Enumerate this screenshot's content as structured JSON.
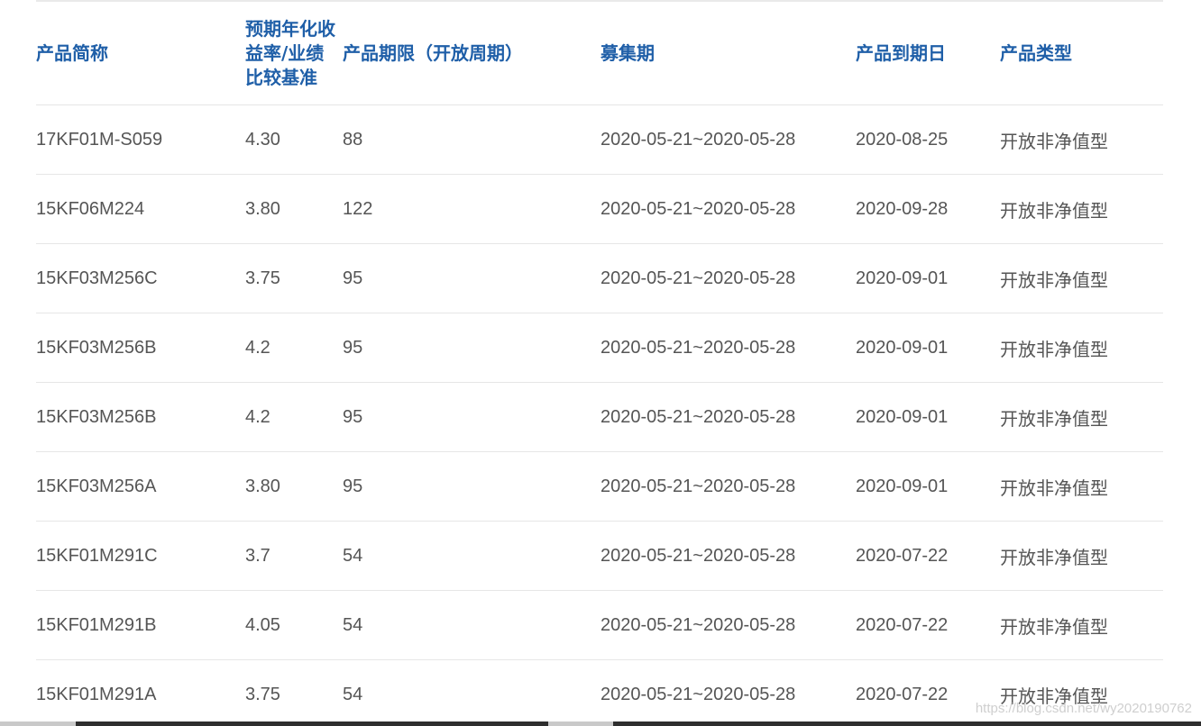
{
  "table": {
    "headers": {
      "name": "产品简称",
      "yield_line1": "预期年化收",
      "yield_line2": "益率/业绩",
      "yield_line3": "比较基准",
      "term": "产品期限（开放周期）",
      "raise_period": "募集期",
      "maturity": "产品到期日",
      "type": "产品类型"
    },
    "rows": [
      {
        "name": "17KF01M-S059",
        "yield": "4.30",
        "term": "88",
        "raise_period": "2020-05-21~2020-05-28",
        "maturity": "2020-08-25",
        "type": "开放非净值型"
      },
      {
        "name": "15KF06M224",
        "yield": "3.80",
        "term": "122",
        "raise_period": "2020-05-21~2020-05-28",
        "maturity": "2020-09-28",
        "type": "开放非净值型"
      },
      {
        "name": "15KF03M256C",
        "yield": "3.75",
        "term": "95",
        "raise_period": "2020-05-21~2020-05-28",
        "maturity": "2020-09-01",
        "type": "开放非净值型"
      },
      {
        "name": "15KF03M256B",
        "yield": "4.2",
        "term": "95",
        "raise_period": "2020-05-21~2020-05-28",
        "maturity": "2020-09-01",
        "type": "开放非净值型"
      },
      {
        "name": "15KF03M256B",
        "yield": "4.2",
        "term": "95",
        "raise_period": "2020-05-21~2020-05-28",
        "maturity": "2020-09-01",
        "type": "开放非净值型"
      },
      {
        "name": "15KF03M256A",
        "yield": "3.80",
        "term": "95",
        "raise_period": "2020-05-21~2020-05-28",
        "maturity": "2020-09-01",
        "type": "开放非净值型"
      },
      {
        "name": "15KF01M291C",
        "yield": "3.7",
        "term": "54",
        "raise_period": "2020-05-21~2020-05-28",
        "maturity": "2020-07-22",
        "type": "开放非净值型"
      },
      {
        "name": "15KF01M291B",
        "yield": "4.05",
        "term": "54",
        "raise_period": "2020-05-21~2020-05-28",
        "maturity": "2020-07-22",
        "type": "开放非净值型"
      },
      {
        "name": "15KF01M291A",
        "yield": "3.75",
        "term": "54",
        "raise_period": "2020-05-21~2020-05-28",
        "maturity": "2020-07-22",
        "type": "开放非净值型"
      }
    ]
  },
  "watermark": "https://blog.csdn.net/wy2020190762",
  "colors": {
    "header_text": "#1f5fa8",
    "cell_text": "#555555",
    "row_divider": "#e6e6e6"
  }
}
